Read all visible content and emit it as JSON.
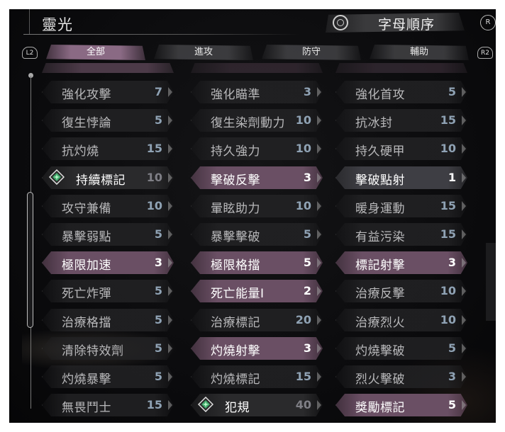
{
  "header": {
    "title": "靈光",
    "sort_label": "字母順序",
    "right_button": "R"
  },
  "tabs": {
    "left_shoulder": "L2",
    "right_shoulder": "R2",
    "items": [
      {
        "label": "全部",
        "active": true
      },
      {
        "label": "進攻",
        "active": false
      },
      {
        "label": "防守",
        "active": false
      },
      {
        "label": "輔助",
        "active": false
      }
    ]
  },
  "colors": {
    "highlight": "#6a4f64",
    "accent_tab": "#8a6a84",
    "number_blue": "#8fa2b4"
  },
  "grid": [
    [
      {
        "name": "強化攻擊",
        "value": "7",
        "state": "normal"
      },
      {
        "name": "強化瞄準",
        "value": "3",
        "state": "normal"
      },
      {
        "name": "強化首攻",
        "value": "5",
        "state": "normal"
      }
    ],
    [
      {
        "name": "復生悖論",
        "value": "5",
        "state": "normal"
      },
      {
        "name": "復生染劑動力",
        "value": "10",
        "state": "normal"
      },
      {
        "name": "抗冰封",
        "value": "15",
        "state": "normal"
      }
    ],
    [
      {
        "name": "抗灼燒",
        "value": "15",
        "state": "normal"
      },
      {
        "name": "持久強力",
        "value": "10",
        "state": "normal"
      },
      {
        "name": "持久硬甲",
        "value": "10",
        "state": "normal"
      }
    ],
    [
      {
        "name": "持續標記",
        "value": "10",
        "state": "equipped"
      },
      {
        "name": "擊破反擊",
        "value": "3",
        "state": "highlight"
      },
      {
        "name": "擊破點射",
        "value": "1",
        "state": "selected"
      }
    ],
    [
      {
        "name": "攻守兼備",
        "value": "10",
        "state": "normal"
      },
      {
        "name": "暈眩助力",
        "value": "10",
        "state": "normal"
      },
      {
        "name": "暖身運動",
        "value": "15",
        "state": "normal"
      }
    ],
    [
      {
        "name": "暴擊弱點",
        "value": "5",
        "state": "normal"
      },
      {
        "name": "暴擊擊破",
        "value": "5",
        "state": "normal"
      },
      {
        "name": "有益污染",
        "value": "15",
        "state": "normal"
      }
    ],
    [
      {
        "name": "極限加速",
        "value": "3",
        "state": "highlight"
      },
      {
        "name": "極限格擋",
        "value": "5",
        "state": "highlight"
      },
      {
        "name": "標記射擊",
        "value": "3",
        "state": "highlight"
      }
    ],
    [
      {
        "name": "死亡炸彈",
        "value": "5",
        "state": "normal"
      },
      {
        "name": "死亡能量I",
        "value": "2",
        "state": "highlight"
      },
      {
        "name": "治療反擊",
        "value": "10",
        "state": "normal"
      }
    ],
    [
      {
        "name": "治療格擋",
        "value": "5",
        "state": "normal"
      },
      {
        "name": "治療標記",
        "value": "20",
        "state": "normal"
      },
      {
        "name": "治療烈火",
        "value": "10",
        "state": "normal"
      }
    ],
    [
      {
        "name": "清除特效劑",
        "value": "5",
        "state": "normal"
      },
      {
        "name": "灼燒射擊",
        "value": "3",
        "state": "highlight"
      },
      {
        "name": "灼燒擊破",
        "value": "5",
        "state": "normal"
      }
    ],
    [
      {
        "name": "灼燒暴擊",
        "value": "5",
        "state": "normal"
      },
      {
        "name": "灼燒標記",
        "value": "15",
        "state": "normal"
      },
      {
        "name": "烈火擊破",
        "value": "3",
        "state": "normal"
      }
    ],
    [
      {
        "name": "無畏鬥士",
        "value": "15",
        "state": "normal"
      },
      {
        "name": "犯規",
        "value": "40",
        "state": "equipped"
      },
      {
        "name": "獎勵標記",
        "value": "5",
        "state": "highlight"
      }
    ]
  ]
}
